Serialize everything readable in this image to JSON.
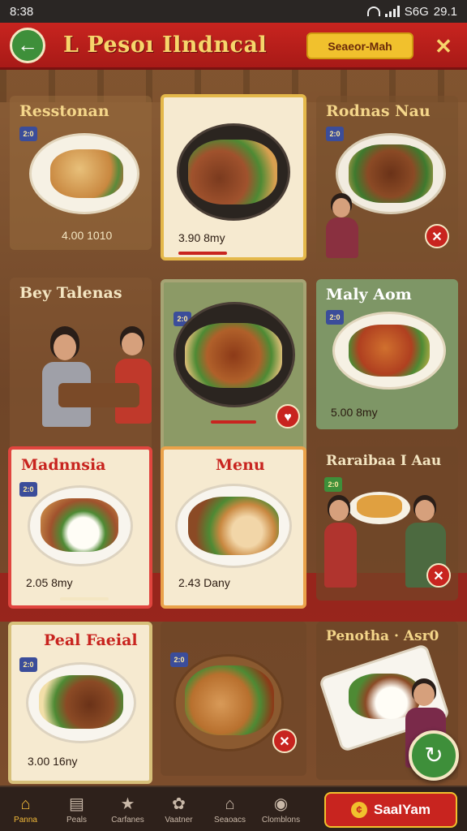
{
  "status_bar": {
    "time": "8:38",
    "network": "S6G",
    "battery": "29.1"
  },
  "header": {
    "title": "L Pesoı Ilndncal",
    "search_label": "Seaeor-Mah",
    "close_icon": "close-icon",
    "back_icon": "back-arrow-icon"
  },
  "cards": [
    {
      "title": "Resstonan",
      "badge": "2:0",
      "price": "4.00 1010"
    },
    {
      "title": "",
      "badge": "",
      "price": "3.90 8my"
    },
    {
      "title": "Rodnas Nau",
      "badge": "2:0",
      "price": ""
    },
    {
      "title": "Bey Talenas",
      "badge": "",
      "price": ""
    },
    {
      "title": "",
      "badge": "2:0",
      "price": ""
    },
    {
      "title": "Maly Aom",
      "badge": "2:0",
      "price": "5.00 8my"
    },
    {
      "title": "Madnnsia",
      "badge": "2:0",
      "price": "2.05 8my"
    },
    {
      "title": "Menu",
      "badge": "",
      "price": "2.43 Dany"
    },
    {
      "title": "Raraibaa I Aau",
      "badge": "2:0",
      "price": ""
    },
    {
      "title": "Peal Faeial",
      "badge": "2:0",
      "price": "3.00 16ny"
    },
    {
      "title": "",
      "badge": "2:0",
      "price": ""
    },
    {
      "title": "Penotha · Asr0",
      "badge": "",
      "price": ""
    }
  ],
  "bottom_nav": [
    {
      "label": "Panna",
      "icon": "home-icon"
    },
    {
      "label": "Peals",
      "icon": "menu-icon"
    },
    {
      "label": "Carfanes",
      "icon": "star-icon"
    },
    {
      "label": "Vaatner",
      "icon": "flower-icon"
    },
    {
      "label": "Seaoacs",
      "icon": "house-icon"
    },
    {
      "label": "Clomblons",
      "icon": "chat-icon"
    }
  ],
  "order_button": {
    "label": "SaaIYam"
  },
  "colors": {
    "primary_red": "#c8241f",
    "accent_yellow": "#f1c12d",
    "accent_green": "#3e8f3a"
  }
}
